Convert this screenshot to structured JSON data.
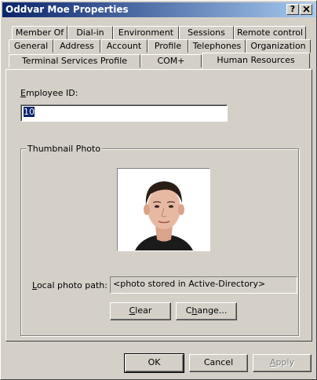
{
  "window": {
    "title": "Oddvar Moe Properties"
  },
  "titlebar_buttons": {
    "help": "?",
    "close_icon": "close-icon"
  },
  "tabs": {
    "row1": [
      "Member Of",
      "Dial-in",
      "Environment",
      "Sessions",
      "Remote control"
    ],
    "row2": [
      "General",
      "Address",
      "Account",
      "Profile",
      "Telephones",
      "Organization"
    ],
    "row3": [
      "Terminal Services Profile",
      "COM+",
      "Human Resources"
    ],
    "active": "Human Resources"
  },
  "employee": {
    "label": "Employee ID:",
    "label_accel": "E",
    "label_rest": "mployee ID:",
    "value": "10"
  },
  "thumbnail": {
    "group_title": "Thumbnail Photo",
    "photo_alt": "employee portrait photo",
    "path_label_accel": "L",
    "path_label_rest": "ocal photo path:",
    "path_value": "<photo stored in Active-Directory>",
    "clear_accel": "C",
    "clear_rest": "lear",
    "change_accel": "h",
    "change_pre": "C",
    "change_rest": "ange..."
  },
  "footer": {
    "ok": "OK",
    "cancel": "Cancel",
    "apply_accel": "A",
    "apply_rest": "pply"
  },
  "colors": {
    "face": "#d4d0c8",
    "titlebar_start": "#0a246a",
    "titlebar_end": "#a6caf0",
    "selection": "#0a246a"
  }
}
